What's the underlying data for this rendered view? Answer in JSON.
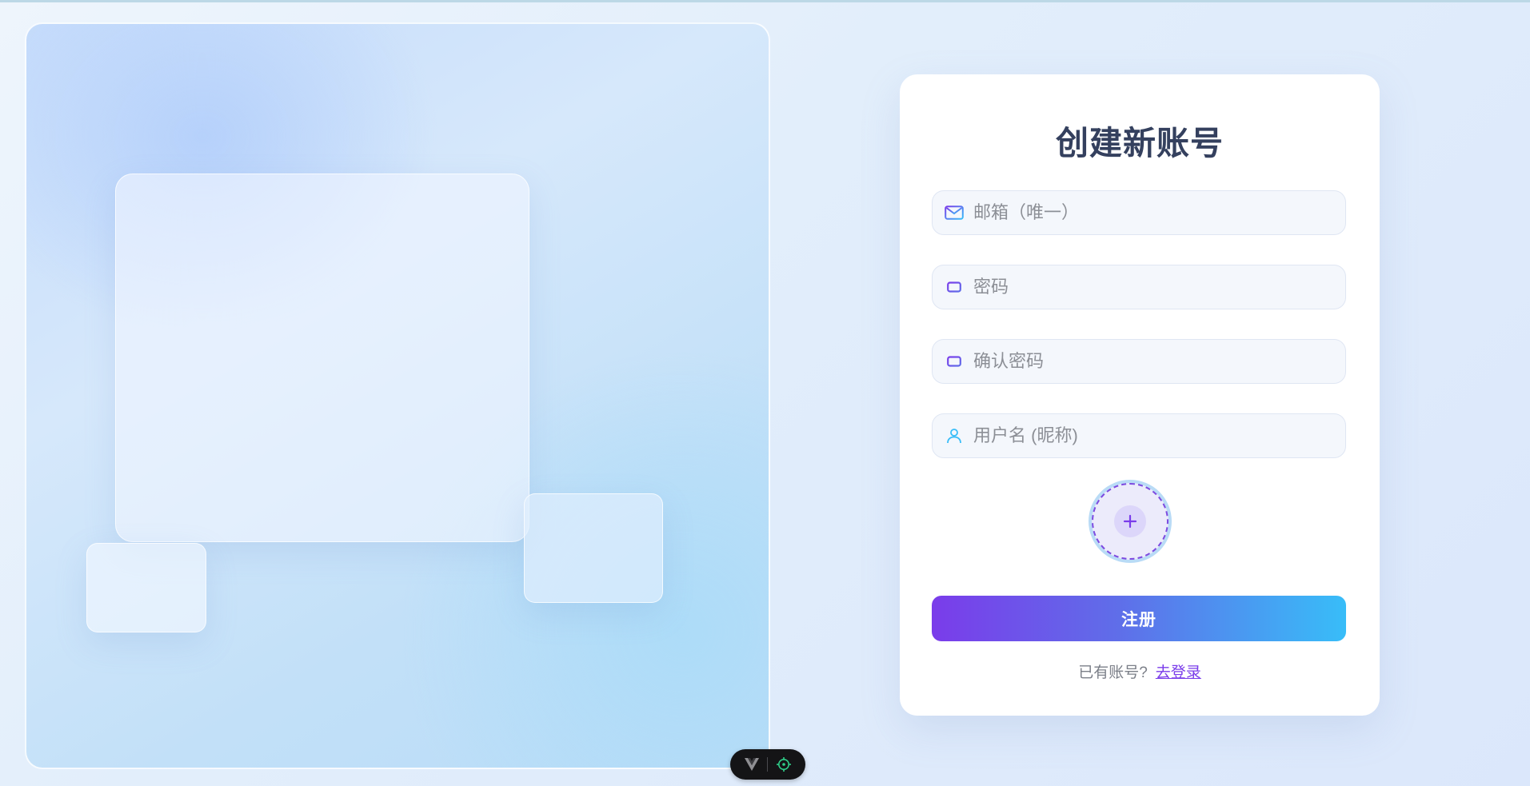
{
  "register": {
    "title": "创建新账号",
    "fields": [
      {
        "placeholder": "邮箱（唯一）",
        "icon": "mail-icon",
        "value": ""
      },
      {
        "placeholder": "密码",
        "icon": "lock-icon",
        "value": ""
      },
      {
        "placeholder": "确认密码",
        "icon": "lock-icon",
        "value": ""
      },
      {
        "placeholder": "用户名 (昵称)",
        "icon": "user-icon",
        "value": ""
      }
    ],
    "avatar_upload_icon": "plus-icon",
    "submit_label": "注册",
    "have_account_text": "已有账号?",
    "login_link": "去登录"
  },
  "colors": {
    "accent_purple": "#7a3cea",
    "accent_blue": "#38bdf8",
    "title": "#34405e"
  }
}
